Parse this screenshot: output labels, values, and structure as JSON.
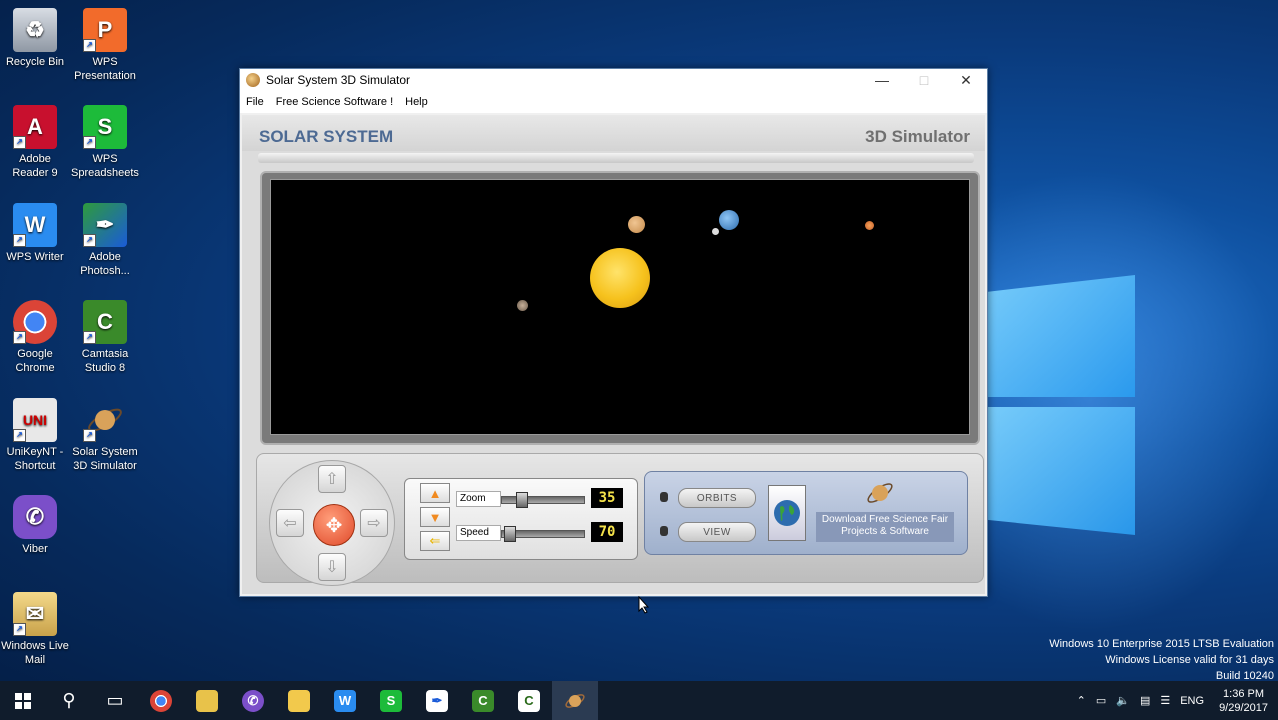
{
  "desktop": {
    "icons": [
      {
        "label": "Recycle Bin"
      },
      {
        "label": "WPS Presentation"
      },
      {
        "label": "Adobe Reader 9"
      },
      {
        "label": "WPS Spreadsheets"
      },
      {
        "label": "WPS Writer"
      },
      {
        "label": "Adobe Photosh..."
      },
      {
        "label": "Google Chrome"
      },
      {
        "label": "Camtasia Studio 8"
      },
      {
        "label": "UniKeyNT - Shortcut"
      },
      {
        "label": "Solar System 3D Simulator"
      },
      {
        "label": "Viber"
      },
      {
        "label": "Windows Live Mail"
      }
    ]
  },
  "window": {
    "title": "Solar System 3D Simulator",
    "menu": [
      "File",
      "Free Science Software !",
      "Help"
    ],
    "header_left": "SOLAR SYSTEM",
    "header_right": "3D Simulator",
    "controls": {
      "zoom_label": "Zoom",
      "zoom_value": "35",
      "speed_label": "Speed",
      "speed_value": "70",
      "orbits_button": "ORBITS",
      "view_button": "VIEW",
      "download_text": "Download Free Science Fair Projects & Software"
    }
  },
  "watermark": {
    "line1": "Windows 10 Enterprise 2015 LTSB Evaluation",
    "line2": "Windows License valid for 31 days",
    "line3": "Build 10240"
  },
  "taskbar": {
    "lang": "ENG",
    "time": "1:36 PM",
    "date": "9/29/2017"
  },
  "colors": {
    "header_title": "#4d6a93",
    "sun": "#f6c21d",
    "taskbar": "#101c2c"
  }
}
